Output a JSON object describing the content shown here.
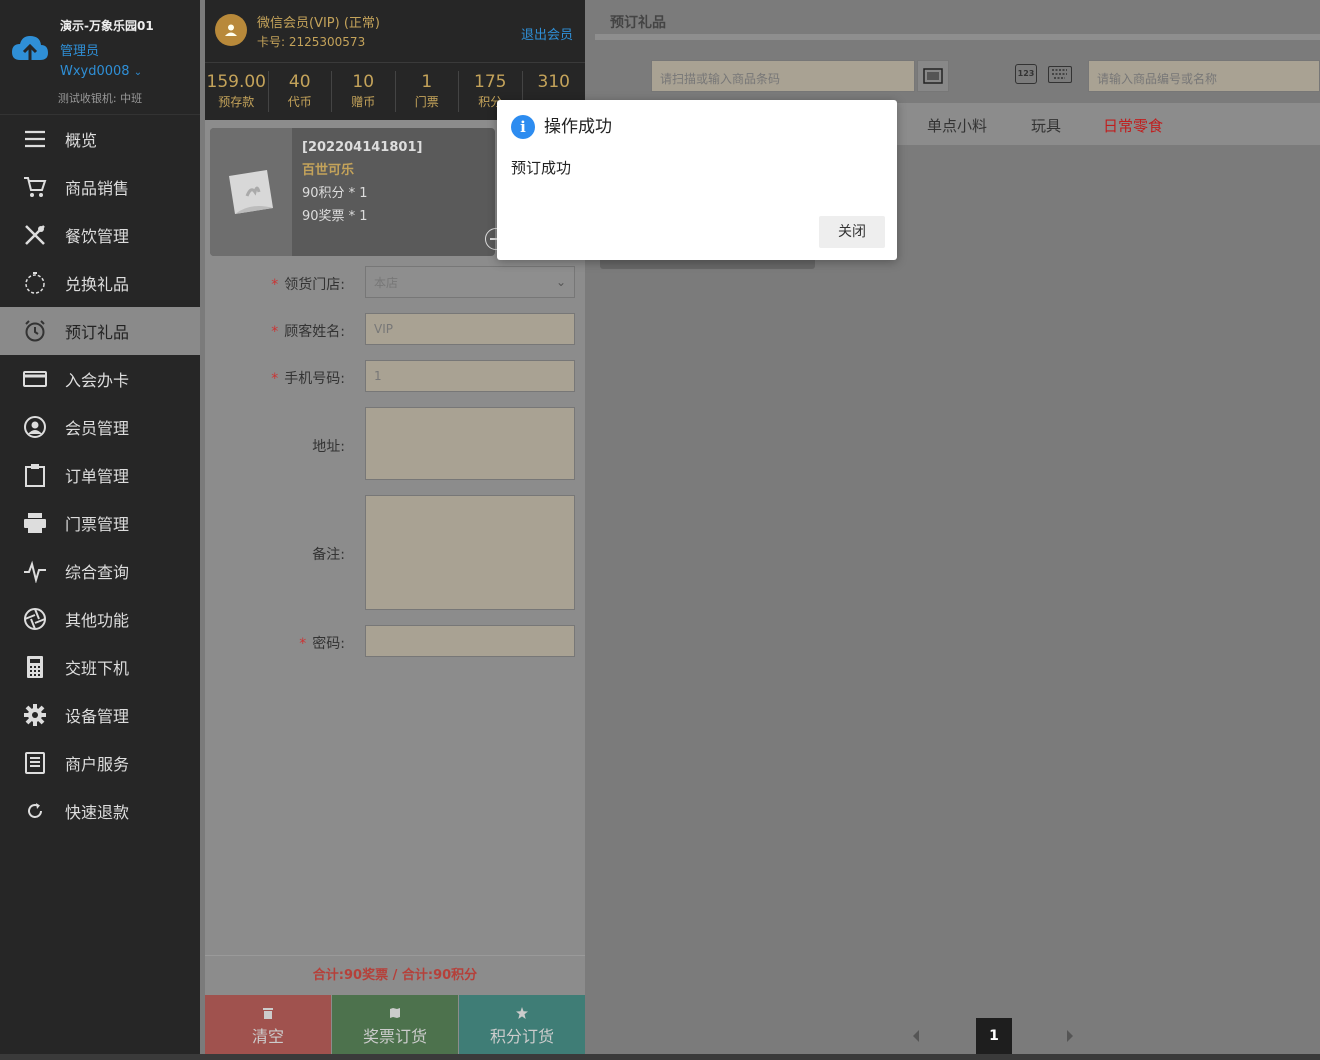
{
  "sidebar": {
    "store_name": "演示-万象乐园01",
    "role": "管理员",
    "username": "Wxyd0008",
    "shift_info": "测试收银机: 中班",
    "items": [
      {
        "label": "概览",
        "icon": "menu-icon"
      },
      {
        "label": "商品销售",
        "icon": "cart-icon"
      },
      {
        "label": "餐饮管理",
        "icon": "utensils-icon"
      },
      {
        "label": "兑换礼品",
        "icon": "gift-icon"
      },
      {
        "label": "预订礼品",
        "icon": "alarm-clock-icon"
      },
      {
        "label": "入会办卡",
        "icon": "card-icon"
      },
      {
        "label": "会员管理",
        "icon": "user-circle-icon"
      },
      {
        "label": "订单管理",
        "icon": "clipboard-icon"
      },
      {
        "label": "门票管理",
        "icon": "printer-icon"
      },
      {
        "label": "综合查询",
        "icon": "pulse-icon"
      },
      {
        "label": "其他功能",
        "icon": "aperture-icon"
      },
      {
        "label": "交班下机",
        "icon": "calculator-icon"
      },
      {
        "label": "设备管理",
        "icon": "gear-icon"
      },
      {
        "label": "商户服务",
        "icon": "book-icon"
      },
      {
        "label": "快速退款",
        "icon": "refresh-icon"
      }
    ],
    "active_index": 4
  },
  "member": {
    "name": "微信会员(VIP) (正常)",
    "card_no": "卡号: 2125300573",
    "logout_label": "退出会员",
    "stats": [
      {
        "value": "159.00",
        "label": "预存款"
      },
      {
        "value": "40",
        "label": "代币"
      },
      {
        "value": "10",
        "label": "赠币"
      },
      {
        "value": "1",
        "label": "门票"
      },
      {
        "value": "175",
        "label": "积分"
      },
      {
        "value": "310",
        "label": ""
      }
    ]
  },
  "cart_item": {
    "code": "[202204141801]",
    "name": "百世可乐",
    "line1": "90积分 * 1",
    "line2": "90奖票 * 1"
  },
  "form": {
    "store_label": "领货门店:",
    "store_value": "本店",
    "name_label": "顾客姓名:",
    "name_value": "VIP",
    "phone_label": "手机号码:",
    "phone_value": "1",
    "address_label": "地址:",
    "remark_label": "备注:",
    "password_label": "密码:",
    "required_mark": "*"
  },
  "total_text": "合计:90奖票 / 合计:90积分",
  "actions": {
    "clear": "清空",
    "ticket_order": "奖票订货",
    "points_order": "积分订货"
  },
  "right": {
    "title": "预订礼品",
    "scan_placeholder": "请扫描或输入商品条码",
    "search_placeholder": "请输入商品编号或名称",
    "keypad_label": "123",
    "categories": [
      "单点小料",
      "玩具",
      "日常零食"
    ],
    "page_current": "1"
  },
  "dialog": {
    "title": "操作成功",
    "message": "预订成功",
    "close_label": "关闭",
    "icon": "i"
  },
  "colors": {
    "accent_blue": "#2d8cf0",
    "gold": "#c4a35a",
    "clear_btn": "#c0504d",
    "ticket_btn": "#4e8a4e",
    "points_btn": "#3f9a8e",
    "hot_category": "#c01e1e"
  }
}
